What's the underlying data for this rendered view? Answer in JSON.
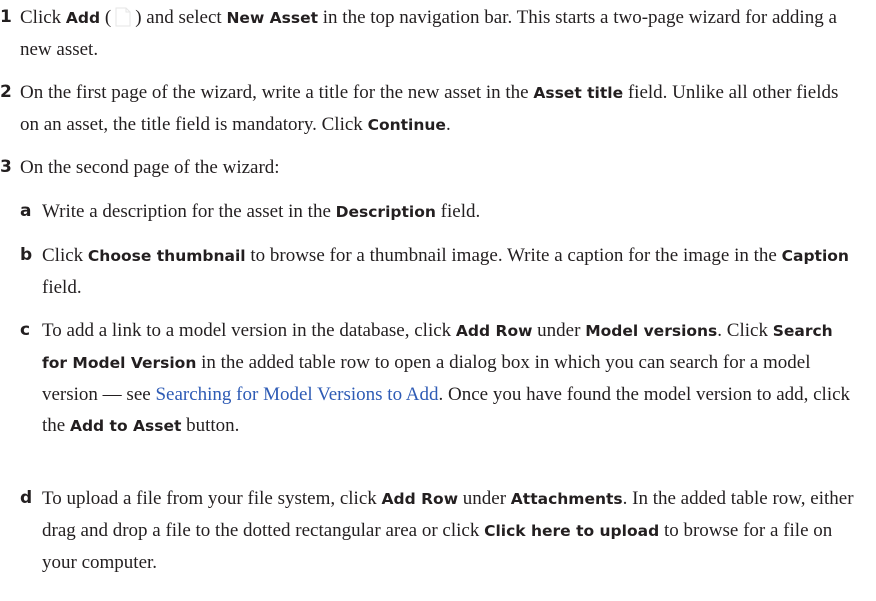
{
  "step1": {
    "num": "1",
    "t1": "Click ",
    "add": "Add",
    "t2": " (",
    "t3": ") and select ",
    "new_asset": "New Asset",
    "t4": " in the top navigation bar. This starts a two-page wizard for adding a new asset."
  },
  "step2": {
    "num": "2",
    "t1": "On the first page of the wizard, write a title for the new asset in the ",
    "asset_title": "Asset title",
    "t2": " field. Unlike all other fields on an asset, the title field is mandatory. Click ",
    "continue": "Continue",
    "t3": "."
  },
  "step3": {
    "num": "3",
    "t1": "On the second page of the wizard:",
    "a": {
      "num": "a",
      "t1": "Write a description for the asset in the ",
      "description": "Description",
      "t2": " field."
    },
    "b": {
      "num": "b",
      "t1": "Click ",
      "choose_thumbnail": "Choose thumbnail",
      "t2": " to browse for a thumbnail image. Write a caption for the image in the ",
      "caption": "Caption",
      "t3": " field."
    },
    "c": {
      "num": "c",
      "t1": "To add a link to a model version in the database, click ",
      "add_row": "Add Row",
      "t2": " under ",
      "model_versions": "Model versions",
      "t3": ". Click ",
      "search": "Search for Model Version",
      "t4": " in the added table row to open a dialog box in which you can search for a model version — see ",
      "link": "Searching for Model Versions to Add",
      "t5": ". Once you have found the model version to add, click the ",
      "add_to_asset": "Add to Asset",
      "t6": " button."
    },
    "d": {
      "num": "d",
      "t1": "To upload a file from your file system, click ",
      "add_row": "Add Row",
      "t2": " under ",
      "attachments": "Attachments",
      "t3": ". In the added table row, either drag and drop a file to the dotted rectangular area or click ",
      "click_upload": "Click here to upload",
      "t4": " to browse for a file on your computer."
    }
  }
}
